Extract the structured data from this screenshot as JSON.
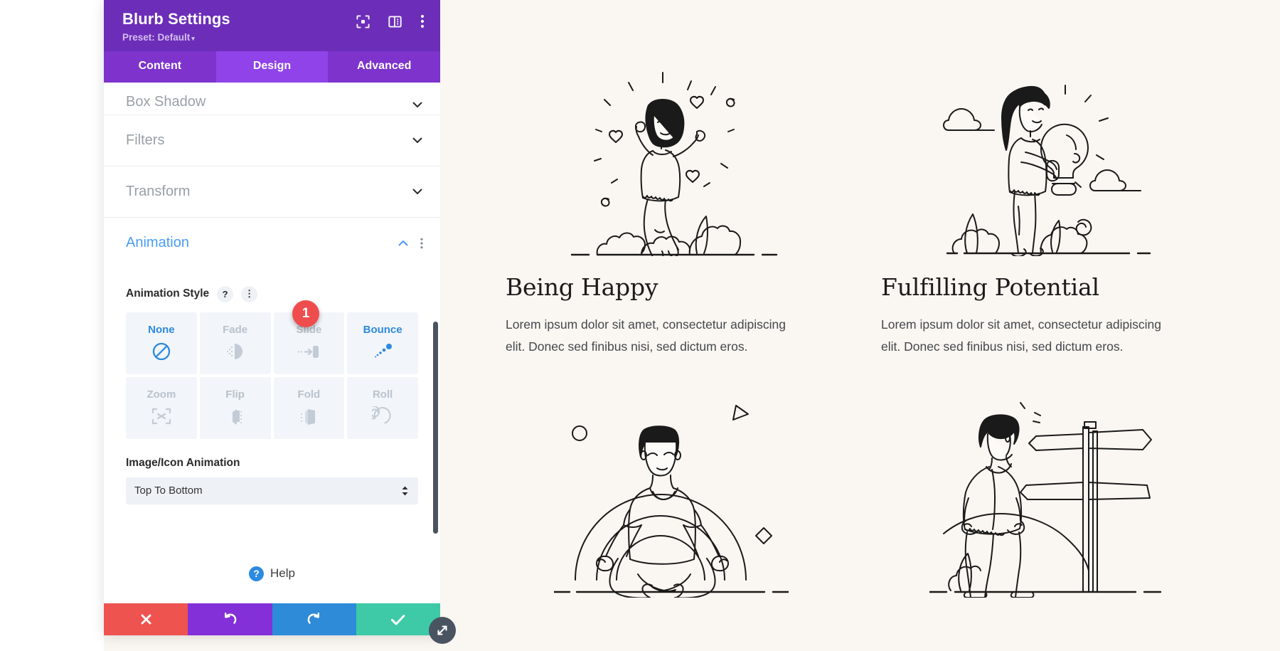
{
  "panel": {
    "title": "Blurb Settings",
    "preset": "Preset: Default",
    "preset_caret": "▾",
    "header_icons": [
      {
        "name": "focus-frame-icon",
        "label": "Focus"
      },
      {
        "name": "layout-panel-icon",
        "label": "Layout"
      },
      {
        "name": "vertical-dots-icon",
        "label": "More Options"
      }
    ],
    "tabs": [
      {
        "label": "Content",
        "active": false
      },
      {
        "label": "Design",
        "active": true
      },
      {
        "label": "Advanced",
        "active": false
      }
    ],
    "sections": [
      {
        "label": "Box Shadow",
        "open": false
      },
      {
        "label": "Filters",
        "open": false
      },
      {
        "label": "Transform",
        "open": false
      },
      {
        "label": "Animation",
        "open": true
      }
    ],
    "animation": {
      "field_label": "Animation Style",
      "help_glyph": "?",
      "options_glyph": "⋮",
      "styles": [
        {
          "label": "None",
          "icon": "no-entry-icon",
          "state": "selected"
        },
        {
          "label": "Fade",
          "icon": "fade-icon",
          "state": "normal"
        },
        {
          "label": "Slide",
          "icon": "slide-icon",
          "state": "normal"
        },
        {
          "label": "Bounce",
          "icon": "bounce-icon",
          "state": "hover"
        },
        {
          "label": "Zoom",
          "icon": "zoom-arrows-icon",
          "state": "normal"
        },
        {
          "label": "Flip",
          "icon": "flip-icon",
          "state": "normal"
        },
        {
          "label": "Fold",
          "icon": "fold-icon",
          "state": "normal"
        },
        {
          "label": "Roll",
          "icon": "roll-spiral-icon",
          "state": "normal"
        }
      ],
      "marker_badge": "1",
      "image_icon_animation_label": "Image/Icon Animation",
      "image_icon_animation_value": "Top To Bottom"
    },
    "help": {
      "glyph": "?",
      "label": "Help"
    },
    "footer_buttons": [
      {
        "name": "cancel-button",
        "glyph": "✕",
        "color": "#ef5350"
      },
      {
        "name": "undo-button",
        "glyph": "↺",
        "color": "#8430d8"
      },
      {
        "name": "redo-button",
        "glyph": "↻",
        "color": "#2d8bd8"
      },
      {
        "name": "save-button",
        "glyph": "✔",
        "color": "#3ec9a7"
      }
    ]
  },
  "colors": {
    "header_purple": "#6c2eb9",
    "tab_purple": "#7d33cc",
    "tab_active_purple": "#9043e8",
    "accent_blue": "#2c8ae0",
    "marker_red": "#ef4d4d",
    "canvas_bg": "#faf6f1"
  },
  "content": {
    "blurbs": [
      {
        "title": "Being Happy",
        "text": "Lorem ipsum dolor sit amet, consectetur adipiscing elit. Donec sed finibus nisi, sed dictum eros.",
        "art": "woman-celebrating-illustration"
      },
      {
        "title": "Fulfilling Potential",
        "text": "Lorem ipsum dolor sit amet, consectetur adipiscing elit. Donec sed finibus nisi, sed dictum eros.",
        "art": "woman-holding-lightbulb-illustration"
      },
      {
        "title": "",
        "text": "",
        "art": "man-meditating-illustration"
      },
      {
        "title": "",
        "text": "",
        "art": "man-at-signpost-illustration"
      }
    ]
  }
}
